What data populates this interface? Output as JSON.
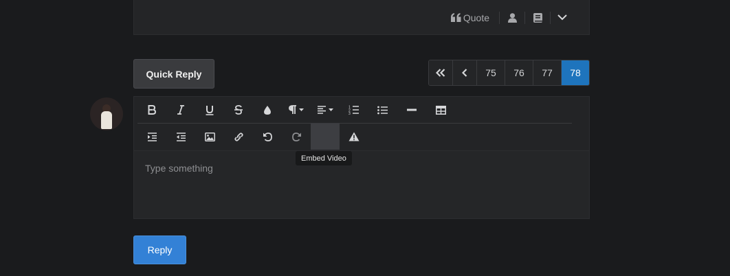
{
  "post_footer": {
    "quote_label": "Quote",
    "icons": [
      "quote-icon",
      "user-icon",
      "book-icon",
      "chevron-down-icon"
    ]
  },
  "quick_reply": {
    "label": "Quick Reply"
  },
  "pagination": {
    "pages": [
      "75",
      "76",
      "77",
      "78"
    ],
    "active_page": "78"
  },
  "editor": {
    "toolbar_row1": [
      "bold",
      "italic",
      "underline",
      "strikethrough",
      "text-color",
      "paragraph-format",
      "align",
      "ordered-list",
      "unordered-list",
      "horizontal-rule",
      "table"
    ],
    "toolbar_row2": [
      "indent",
      "outdent",
      "insert-image",
      "insert-link",
      "undo",
      "redo",
      "embed-video",
      "warning"
    ],
    "placeholder": "Type something",
    "tooltip": "Embed Video"
  },
  "reply": {
    "label": "Reply"
  },
  "colors": {
    "accent": "#1e74bd",
    "reply_button": "#3381d6",
    "background": "#1a1b1d",
    "panel": "#242527"
  }
}
